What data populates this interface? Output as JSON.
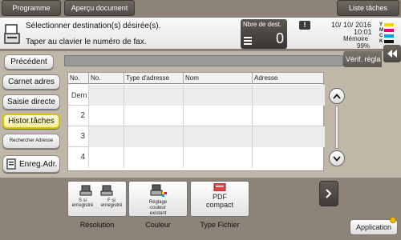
{
  "top_buttons": {
    "programme": "Programme",
    "apercu": "Aperçu document",
    "liste_taches": "Liste tâches"
  },
  "header": {
    "instruction": "Sélectionner destination(s) désirée(s).",
    "fax_hint": "Taper au clavier le numéro de fax.",
    "dest_label": "Nbre de dest.",
    "dest_count": "0",
    "warning": "!",
    "date": "10/ 10/ 2016",
    "time": "10:01",
    "memory_label": "Mémoire",
    "memory_value": "99%",
    "toner": [
      "Y",
      "M",
      "C",
      "K"
    ]
  },
  "toolbar": {
    "verif_label": "Vérif. régla"
  },
  "sidebar": {
    "items": [
      {
        "label": "Précédent"
      },
      {
        "label": "Carnet adres"
      },
      {
        "label": "Saisie directe"
      },
      {
        "label": "Histor.tâches"
      },
      {
        "label": "Rechercher Adresse"
      },
      {
        "label": "Enreg.Adr."
      }
    ]
  },
  "table": {
    "headers": [
      "No.",
      "No.",
      "Type d'adresse",
      "Nom",
      "Adresse"
    ],
    "rows": [
      "Dern",
      "2",
      "3",
      "4"
    ]
  },
  "bottom": {
    "tiles": [
      {
        "text1": "S si enregistré",
        "text2": "F si enregistré",
        "label": "Résolution"
      },
      {
        "text1": "Réglage couleur existant",
        "label": "Couleur"
      },
      {
        "text1": "PDF",
        "text2": "compact",
        "label": "Type Fichier"
      }
    ],
    "application": "Application"
  }
}
